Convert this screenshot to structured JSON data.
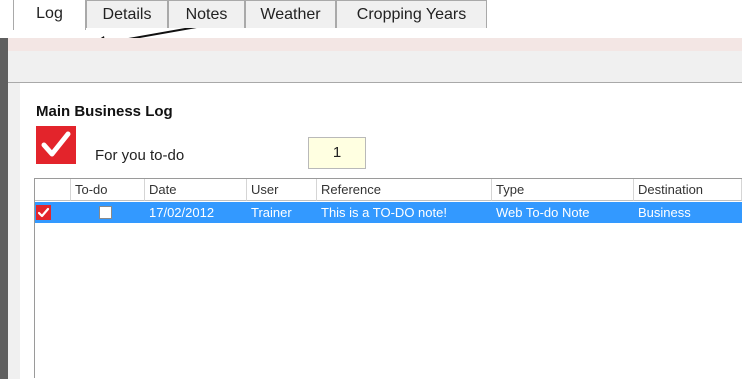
{
  "tabs": [
    {
      "label": "Log",
      "active": true
    },
    {
      "label": "Details",
      "active": false
    },
    {
      "label": "Notes",
      "active": false
    },
    {
      "label": "Weather",
      "active": false
    },
    {
      "label": "Cropping Years",
      "active": false
    }
  ],
  "section": {
    "title": "Main Business Log",
    "for_you_label": "For you to-do",
    "for_you_count": "1"
  },
  "grid": {
    "columns": [
      "",
      "To-do",
      "Date",
      "User",
      "Reference",
      "Type",
      "Destination"
    ],
    "rows": [
      {
        "selected": true,
        "done_icon": "red-check-icon",
        "todo_checked": false,
        "date": "17/02/2012",
        "user": "Trainer",
        "reference": "This is a TO-DO note!",
        "type": "Web To-do Note",
        "destination": "Business"
      }
    ]
  },
  "colors": {
    "accent_red": "#e3242b",
    "selection_blue": "#3399ff",
    "count_box_bg": "#ffffe1"
  },
  "annotation": {
    "icon": "arrow-icon"
  }
}
